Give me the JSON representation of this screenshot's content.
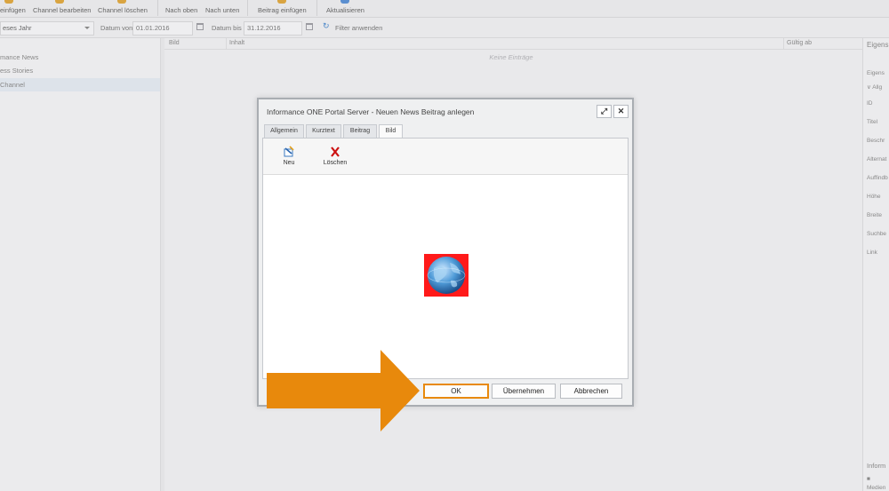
{
  "toolbar": {
    "items": [
      {
        "label": "einfügen",
        "icon": "add-icon"
      },
      {
        "label": "Channel bearbeiten",
        "icon": "edit-icon"
      },
      {
        "label": "Channel löschen",
        "icon": "delete-icon"
      },
      {
        "label": "Nach oben",
        "icon": "arrow-up-icon"
      },
      {
        "label": "Nach unten",
        "icon": "arrow-down-icon"
      },
      {
        "label": "Beitrag einfügen",
        "icon": "add-post-icon"
      },
      {
        "label": "Aktualisieren",
        "icon": "refresh-icon"
      }
    ]
  },
  "filter": {
    "period_select": "eses Jahr",
    "date_from_label": "Datum von",
    "date_from_value": "01.01.2016",
    "date_to_label": "Datum bis",
    "date_to_value": "31.12.2016",
    "apply_label": "Filter anwenden"
  },
  "tree": {
    "items": [
      "mance News",
      "ess Stories",
      "Channel"
    ],
    "selected_index": 2
  },
  "list": {
    "columns": [
      "Bild",
      "Inhalt",
      "Gültig ab"
    ],
    "empty_text": "Keine Einträge"
  },
  "properties_panel": {
    "title": "Eigens",
    "subtitle": "Eigens",
    "group": "Allg",
    "fields": [
      "ID",
      "Titel",
      "Beschr",
      "Alternat",
      "Auffindb",
      "Höhe",
      "Breite",
      "Suchbe",
      "Link"
    ],
    "bottom_title": "Inform",
    "bottom_label": "Medien"
  },
  "dialog": {
    "title": "Informance ONE Portal Server - Neuen News Beitrag anlegen",
    "tabs": [
      "Allgemein",
      "Kurztext",
      "Beitrag",
      "Bild"
    ],
    "active_tab": 3,
    "toolbar": {
      "new_label": "Neu",
      "delete_label": "Löschen"
    },
    "buttons": {
      "ok": "OK",
      "apply": "Übernehmen",
      "cancel": "Abbrechen"
    }
  },
  "colors": {
    "highlight": "#e8890c",
    "image_background": "#ff1a1a",
    "delete_icon": "#cc1111"
  }
}
